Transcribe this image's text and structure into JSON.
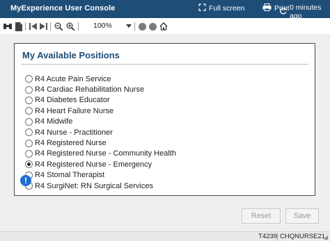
{
  "titlebar": {
    "title": "MyExperience User Console",
    "fullscreen_label": "Full screen",
    "print_label": "Print",
    "refresh_label": "0 minutes ago"
  },
  "toolbar": {
    "zoom_value": "100%"
  },
  "panel": {
    "title": "My Available Positions",
    "options": [
      {
        "label": "R4 Acute Pain Service",
        "checked": false
      },
      {
        "label": "R4 Cardiac Rehabilitation Nurse",
        "checked": false
      },
      {
        "label": "R4 Diabetes Educator",
        "checked": false
      },
      {
        "label": "R4 Heart Failure Nurse",
        "checked": false
      },
      {
        "label": "R4 Midwife",
        "checked": false
      },
      {
        "label": "R4 Nurse - Practitioner",
        "checked": false
      },
      {
        "label": "R4 Registered Nurse",
        "checked": false
      },
      {
        "label": "R4 Registered Nurse - Community Health",
        "checked": false
      },
      {
        "label": "R4 Registered Nurse - Emergency",
        "checked": true
      },
      {
        "label": "R4 Stomal Therapist",
        "checked": false
      },
      {
        "label": "R4 SurgiNet: RN Surgical Services",
        "checked": false
      }
    ]
  },
  "buttons": {
    "reset_label": "Reset",
    "save_label": "Save"
  },
  "statusbar": {
    "code": "T4239",
    "user": "CHQNURSE21"
  },
  "colors": {
    "titlebar_bg": "#1e4d78",
    "panel_title": "#1e4d78",
    "info_icon": "#1f6fd0"
  }
}
